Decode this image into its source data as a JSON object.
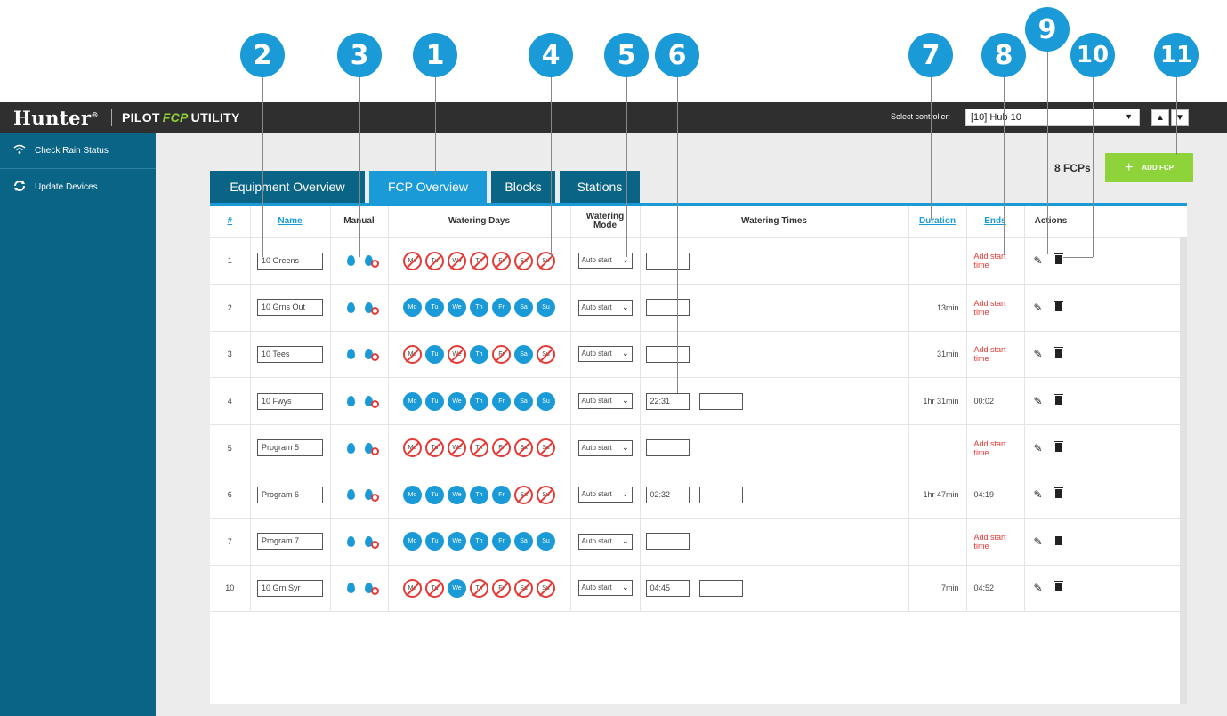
{
  "header": {
    "logo": "Hunter",
    "logo_reg": "®",
    "title_prefix": "PILOT",
    "title_accent": "FCP",
    "title_suffix": "UTILITY",
    "select_label": "Select controller:",
    "select_value": "[10] Hub 10",
    "select_caret": "▼",
    "up_icon": "▲",
    "down_icon": "▼"
  },
  "sidebar": {
    "items": [
      {
        "label": "Check Rain Status",
        "icon": "wifi-icon"
      },
      {
        "label": "Update Devices",
        "icon": "refresh-icon"
      }
    ]
  },
  "main": {
    "fcp_count": "8 FCPs",
    "add_button": "ADD FCP",
    "add_icon": "+",
    "tabs": [
      {
        "label": "Equipment Overview",
        "active": false
      },
      {
        "label": "FCP Overview",
        "active": true
      },
      {
        "label": "Blocks",
        "active": false
      },
      {
        "label": "Stations",
        "active": false
      }
    ]
  },
  "table": {
    "headers": {
      "num": "#",
      "name": "Name",
      "manual": "Manual",
      "days": "Watering Days",
      "mode": "Watering Mode",
      "times": "Watering Times",
      "duration": "Duration",
      "ends": "Ends",
      "actions": "Actions"
    },
    "day_labels": [
      "Mo",
      "Tu",
      "We",
      "Th",
      "Fr",
      "Sa",
      "Su"
    ],
    "rows": [
      {
        "num": "1",
        "name": "10 Greens",
        "days": [
          0,
          0,
          0,
          0,
          0,
          0,
          0
        ],
        "mode": "Auto start",
        "times": [
          ""
        ],
        "duration": "",
        "ends": "Add start time",
        "ends_warn": true
      },
      {
        "num": "2",
        "name": "10 Grns Out",
        "days": [
          1,
          1,
          1,
          1,
          1,
          1,
          1
        ],
        "mode": "Auto start",
        "times": [
          ""
        ],
        "duration": "13min",
        "ends": "Add start time",
        "ends_warn": true
      },
      {
        "num": "3",
        "name": "10 Tees",
        "days": [
          0,
          1,
          0,
          1,
          0,
          1,
          0
        ],
        "mode": "Auto start",
        "times": [
          ""
        ],
        "duration": "31min",
        "ends": "Add start time",
        "ends_warn": true
      },
      {
        "num": "4",
        "name": "10 Fwys",
        "days": [
          1,
          1,
          1,
          1,
          1,
          1,
          1
        ],
        "mode": "Auto start",
        "times": [
          "22:31",
          ""
        ],
        "duration": "1hr 31min",
        "ends": "00:02",
        "ends_warn": false
      },
      {
        "num": "5",
        "name": "Program 5",
        "days": [
          0,
          0,
          0,
          0,
          0,
          0,
          0
        ],
        "mode": "Auto start",
        "times": [
          ""
        ],
        "duration": "",
        "ends": "Add start time",
        "ends_warn": true
      },
      {
        "num": "6",
        "name": "Program 6",
        "days": [
          1,
          1,
          1,
          1,
          1,
          0,
          0
        ],
        "mode": "Auto start",
        "times": [
          "02:32",
          ""
        ],
        "duration": "1hr 47min",
        "ends": "04:19",
        "ends_warn": false
      },
      {
        "num": "7",
        "name": "Program 7",
        "days": [
          1,
          1,
          1,
          1,
          1,
          1,
          1
        ],
        "mode": "Auto start",
        "times": [
          ""
        ],
        "duration": "",
        "ends": "Add start time",
        "ends_warn": true
      },
      {
        "num": "10",
        "name": "10 Grn Syr",
        "days": [
          0,
          0,
          1,
          0,
          0,
          0,
          0
        ],
        "mode": "Auto start",
        "times": [
          "04:45",
          ""
        ],
        "duration": "7min",
        "ends": "04:52",
        "ends_warn": false
      }
    ]
  },
  "callouts": [
    "1",
    "2",
    "3",
    "4",
    "5",
    "6",
    "7",
    "8",
    "9",
    "10",
    "11"
  ],
  "colors": {
    "accent": "#1b9ad8",
    "nav": "#0a6486",
    "green": "#8ed33a",
    "warn": "#e53935",
    "topbar": "#2f2f2f"
  }
}
